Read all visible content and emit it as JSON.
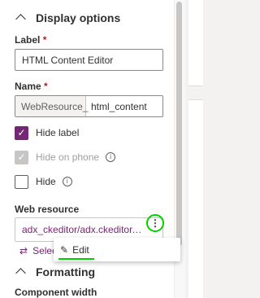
{
  "display_options": {
    "title": "Display options",
    "label_field": {
      "label": "Label",
      "required_mark": "*",
      "value": "HTML Content Editor"
    },
    "name_field": {
      "label": "Name",
      "required_mark": "*",
      "prefix": "WebResource_",
      "value": "html_content"
    },
    "checkboxes": [
      {
        "label": "Hide label",
        "checked": true,
        "disabled": false
      },
      {
        "label": "Hide on phone",
        "checked": true,
        "disabled": true
      },
      {
        "label": "Hide",
        "checked": false,
        "disabled": false
      }
    ],
    "web_resource": {
      "label": "Web resource",
      "value": "adx_ckeditor/adx.ckeditor.h...",
      "more_glyph": "⋮",
      "select_label": "Select"
    }
  },
  "context_menu": {
    "items": [
      {
        "label": "Edit"
      }
    ]
  },
  "formatting": {
    "title": "Formatting",
    "component_width_label": "Component width"
  },
  "icons": {
    "info": "i",
    "check": "✓",
    "pencil": "✎",
    "swap": "⇄"
  },
  "colors": {
    "accent": "#742774",
    "annotation": "#00d100",
    "required": "#a4262c"
  }
}
